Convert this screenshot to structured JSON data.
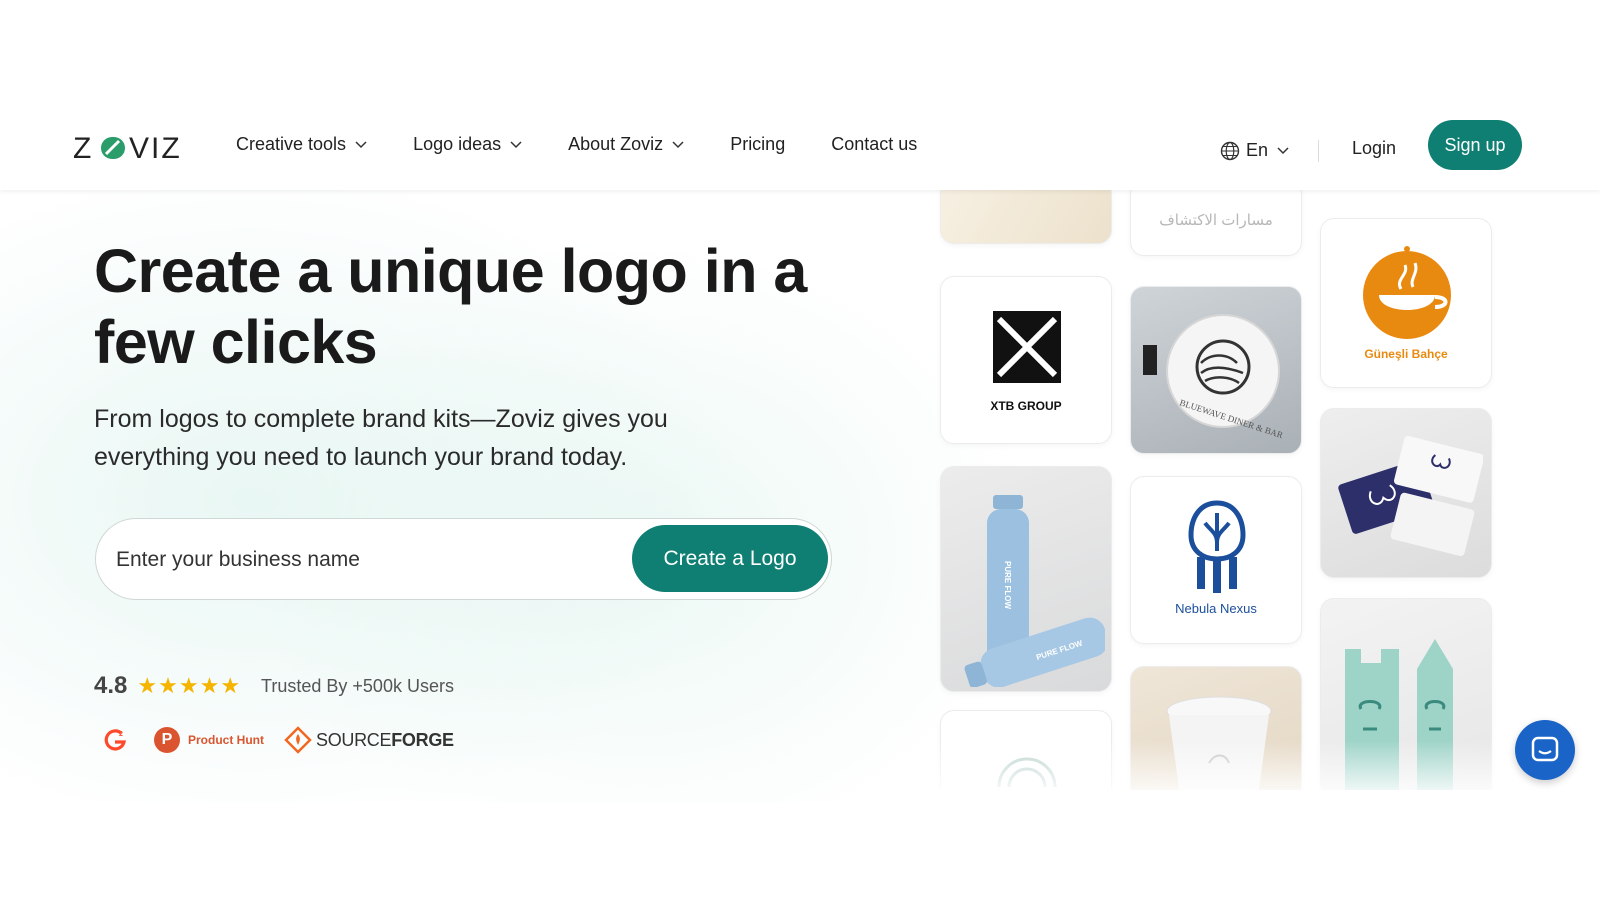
{
  "brand": {
    "name": "ZOVIZ"
  },
  "nav": {
    "items": [
      {
        "label": "Creative tools",
        "dropdown": true
      },
      {
        "label": "Logo ideas",
        "dropdown": true
      },
      {
        "label": "About Zoviz",
        "dropdown": true
      },
      {
        "label": "Pricing",
        "dropdown": false
      },
      {
        "label": "Contact us",
        "dropdown": false
      }
    ],
    "language": "En",
    "login": "Login",
    "signup": "Sign up"
  },
  "hero": {
    "headline": "Create a unique logo in a few clicks",
    "subtext": "From logos to complete brand kits—Zoviz gives you everything you need to launch your brand today.",
    "search_placeholder": "Enter your business name",
    "cta": "Create a Logo",
    "rating": "4.8",
    "stars": 5,
    "trusted": "Trusted By +500k Users",
    "badges": {
      "g2": "G2",
      "product_hunt": "Product Hunt",
      "sourceforge_light": "SOURCE",
      "sourceforge_bold": "FORGE"
    }
  },
  "gallery": {
    "arabic_text": "مسارات الاكتشاف",
    "xtb": "XTB GROUP",
    "bluewave": "BLUEWAVE DINER & BAR",
    "gunesli": "Güneşli Bahçe",
    "nebula": "Nebula Nexus",
    "bottle_text": "PURE FLOW"
  },
  "colors": {
    "primary": "#0e7f72",
    "star": "#f4b400",
    "chat": "#1a64c8",
    "nebula_blue": "#1b4f9c",
    "gunesli_orange": "#e98a10"
  }
}
